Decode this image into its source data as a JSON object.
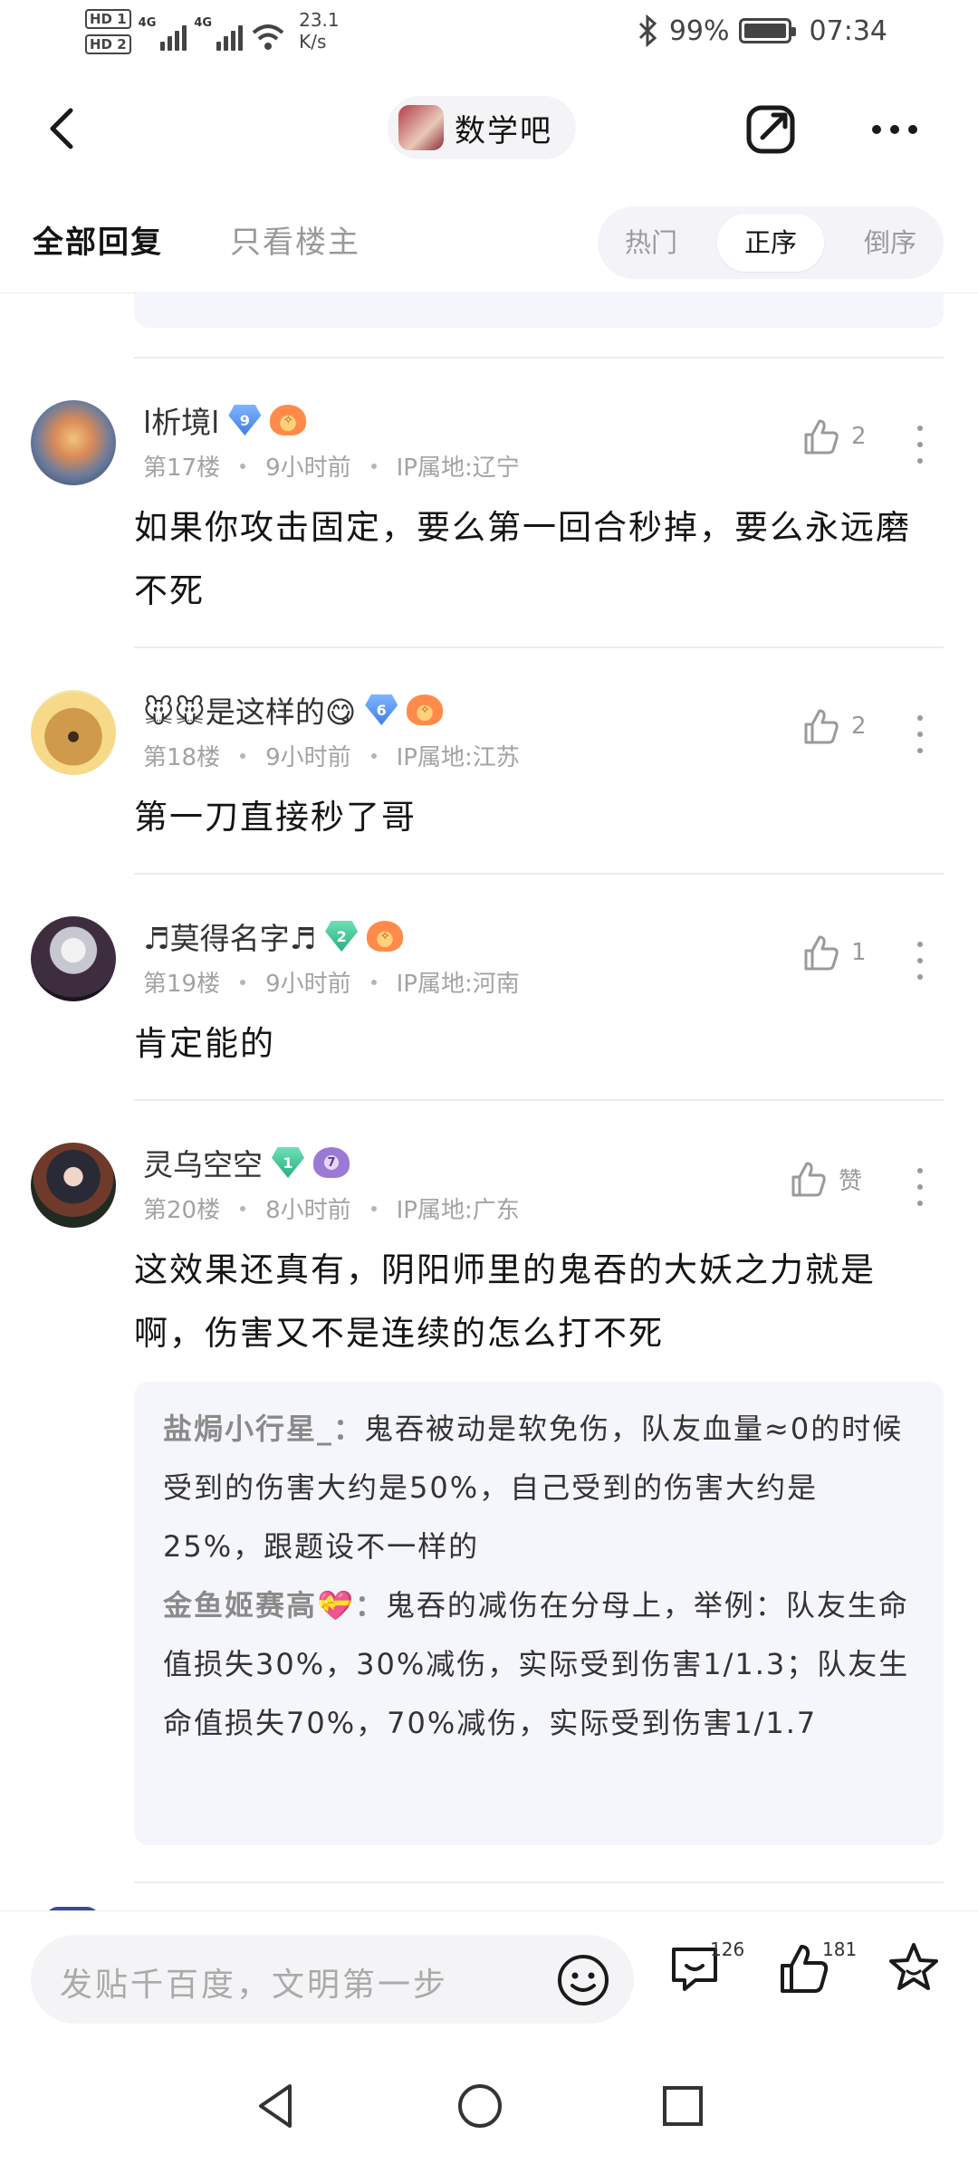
{
  "status_bar": {
    "sim1": "HD 1",
    "sim2": "HD 2",
    "net1": "4G",
    "net2": "4G",
    "speed_value": "23.1",
    "speed_unit": "K/s",
    "battery": "99%",
    "battery_level": 0.99,
    "time": "07:34"
  },
  "header": {
    "forum_name": "数学吧"
  },
  "tabs": {
    "all": "全部回复",
    "owner_only": "只看楼主",
    "sort": [
      "热门",
      "正序",
      "倒序"
    ],
    "sort_active": "正序"
  },
  "posts": [
    {
      "username": "l析境l",
      "level": "9",
      "floor": "第17楼",
      "time": "9小时前",
      "ip": "IP属地:辽宁",
      "likes": "2",
      "content": "如果你攻击固定，要么第一回合秒掉，要么永远磨不死"
    },
    {
      "username": "🐭🐭是这样的😋",
      "level": "6",
      "floor": "第18楼",
      "time": "9小时前",
      "ip": "IP属地:江苏",
      "likes": "2",
      "content": "第一刀直接秒了哥"
    },
    {
      "username": "♬莫得名字♬",
      "level": "2",
      "floor": "第19楼",
      "time": "9小时前",
      "ip": "IP属地:河南",
      "likes": "1",
      "content": "肯定能的"
    },
    {
      "username": "灵乌空空",
      "level": "1",
      "medal": "7",
      "floor": "第20楼",
      "time": "8小时前",
      "ip": "IP属地:广东",
      "likes": "赞",
      "content": "这效果还真有，阴阳师里的鬼吞的大妖之力就是啊，伤害又不是连续的怎么打不死",
      "sub_replies": [
        {
          "name": "盐焗小行星_：",
          "text": "鬼吞被动是软免伤，队友血量≈0的时候受到的伤害大约是50%，自己受到的伤害大约是25%，跟题设不一样的"
        },
        {
          "name": "金鱼姬赛高💝：",
          "text": "鬼吞的减伤在分母上，举例：队友生命值损失30%，30%减伤，实际受到伤害1/1.3；队友生命值损失70%，70%减伤，实际受到伤害1/1.7"
        }
      ]
    }
  ],
  "bottom_bar": {
    "placeholder": "发贴千百度，文明第一步",
    "comment_count": "126",
    "like_count": "181"
  },
  "colors": {
    "accent_blue": "#3f7fe6",
    "level_green": "#26b07f",
    "subreply_bg": "#f5f6fb",
    "text_primary": "#141414",
    "text_meta": "#a3a3a3"
  }
}
